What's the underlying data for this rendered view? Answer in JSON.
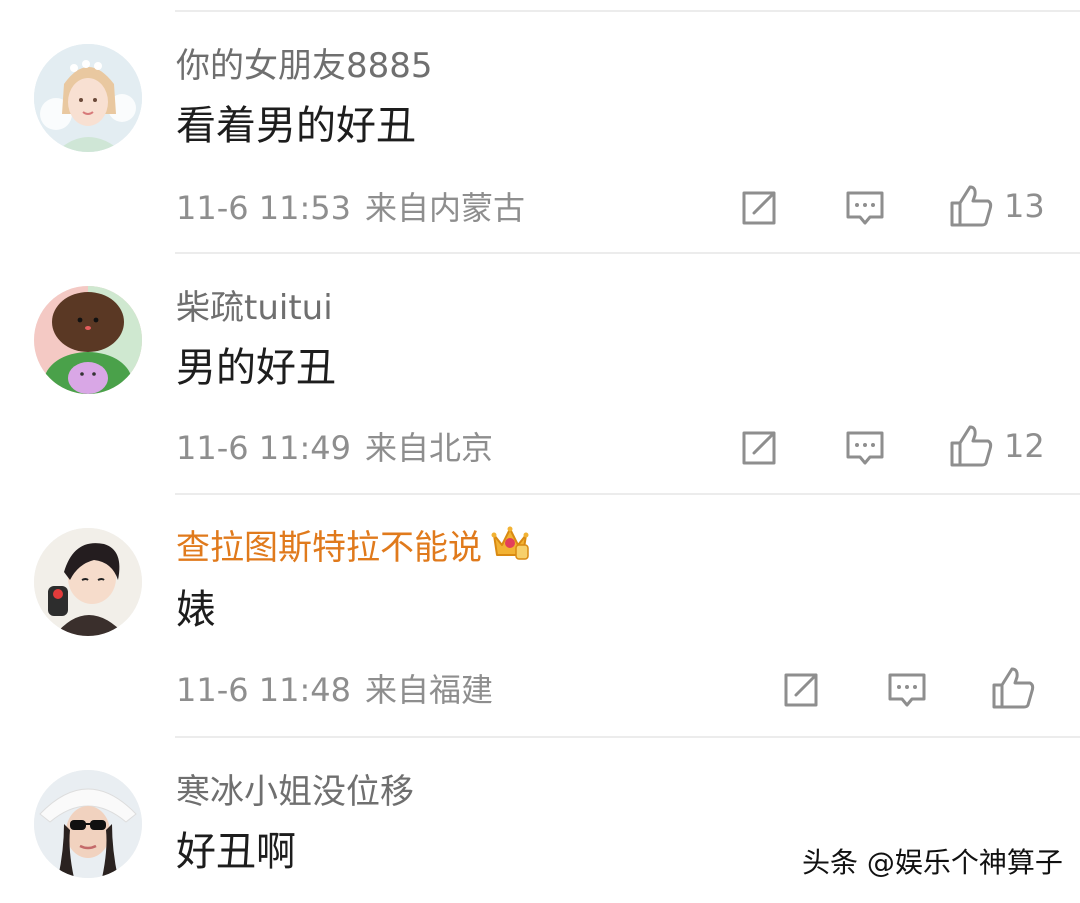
{
  "comments": [
    {
      "username": "你的女朋友8885",
      "text": "看着男的好丑",
      "time": "11-6 11:53",
      "location": "来自内蒙古",
      "likes": "13"
    },
    {
      "username": "柴疏tuitui",
      "text": "男的好丑",
      "time": "11-6 11:49",
      "location": "来自北京",
      "likes": "12"
    },
    {
      "username": "查拉图斯特拉不能说",
      "text": "婊",
      "time": "11-6 11:48",
      "location": "来自福建",
      "likes": "",
      "badge_icon": "vip-crown-icon",
      "username_color": "#e07a1c"
    },
    {
      "username": "寒冰小姐没位移",
      "text": "好丑啊"
    }
  ],
  "icons": {
    "share": "share-icon",
    "reply": "comment-icon",
    "like": "thumbs-up-icon"
  },
  "watermark": "头条 @娱乐个神算子",
  "colors": {
    "username": "#6f6f6f",
    "vip_username": "#e07a1c",
    "meta": "#8e8e8e",
    "divider": "#ececec"
  }
}
